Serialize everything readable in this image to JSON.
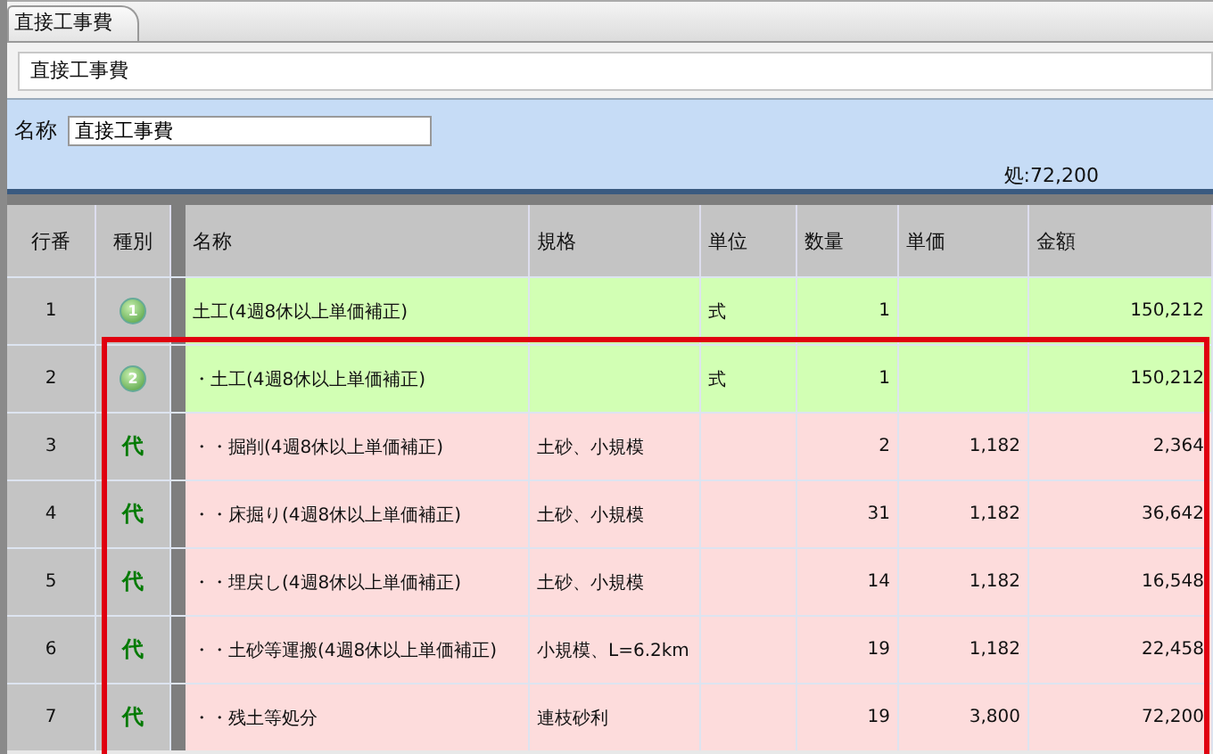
{
  "tab": {
    "label": "直接工事費",
    "selected": true
  },
  "breadcrumb": "直接工事費",
  "form": {
    "name_label": "名称",
    "name_value": "直接工事費",
    "total": "処:72,200"
  },
  "table": {
    "columns": [
      "行番",
      "種別",
      "名称",
      "規格",
      "単位",
      "数量",
      "単価",
      "金額"
    ],
    "rows": [
      {
        "no": "1",
        "kind": "group",
        "badge": "1",
        "name": "土工(4週8休以上単価補正)",
        "spec": "",
        "unit": "式",
        "qty": "1",
        "price": "",
        "amount": "150,212",
        "highlighted": false
      },
      {
        "no": "2",
        "kind": "group",
        "badge": "2",
        "name": "・土工(4週8休以上単価補正)",
        "spec": "",
        "unit": "式",
        "qty": "1",
        "price": "",
        "amount": "150,212",
        "highlighted": true
      },
      {
        "no": "3",
        "kind": "item",
        "badge": "代",
        "name": "・・掘削(4週8休以上単価補正)",
        "spec": "土砂、小規模",
        "unit": "",
        "qty": "2",
        "price": "1,182",
        "amount": "2,364",
        "highlighted": true
      },
      {
        "no": "4",
        "kind": "item",
        "badge": "代",
        "name": "・・床掘り(4週8休以上単価補正)",
        "spec": "土砂、小規模",
        "unit": "",
        "qty": "31",
        "price": "1,182",
        "amount": "36,642",
        "highlighted": true
      },
      {
        "no": "5",
        "kind": "item",
        "badge": "代",
        "name": "・・埋戻し(4週8休以上単価補正)",
        "spec": "土砂、小規模",
        "unit": "",
        "qty": "14",
        "price": "1,182",
        "amount": "16,548",
        "highlighted": true
      },
      {
        "no": "6",
        "kind": "item",
        "badge": "代",
        "name": "・・土砂等運搬(4週8休以上単価補正)",
        "spec": "小規模、L=6.2km",
        "unit": "",
        "qty": "19",
        "price": "1,182",
        "amount": "22,458",
        "highlighted": true
      },
      {
        "no": "7",
        "kind": "item",
        "badge": "代",
        "name": "・・残土等処分",
        "spec": "連枝砂利",
        "unit": "",
        "qty": "19",
        "price": "3,800",
        "amount": "72,200",
        "highlighted": true
      }
    ]
  }
}
